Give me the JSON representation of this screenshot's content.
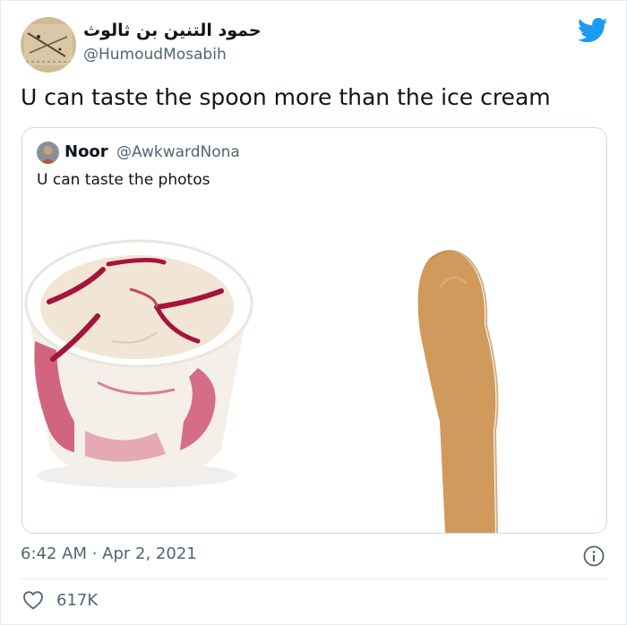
{
  "tweet": {
    "author_name": "حمود التنين بن ثالوث",
    "author_handle": "@HumoudMosabih",
    "text": "U can taste the spoon more than the ice cream",
    "timestamp": "6:42 AM · Apr 2, 2021",
    "likes": "617K"
  },
  "quoted": {
    "name": "Noor",
    "handle": "@AwkwardNona",
    "text": "U can taste the photos",
    "media": [
      "ice-cream-cup-photo",
      "wooden-spoon-photo"
    ]
  },
  "colors": {
    "brand": "#1d9bf0",
    "text": "#0f1419",
    "secondary": "#536471",
    "border": "#cfd9de"
  },
  "icons": [
    "twitter-bird-icon",
    "info-icon",
    "heart-icon"
  ]
}
